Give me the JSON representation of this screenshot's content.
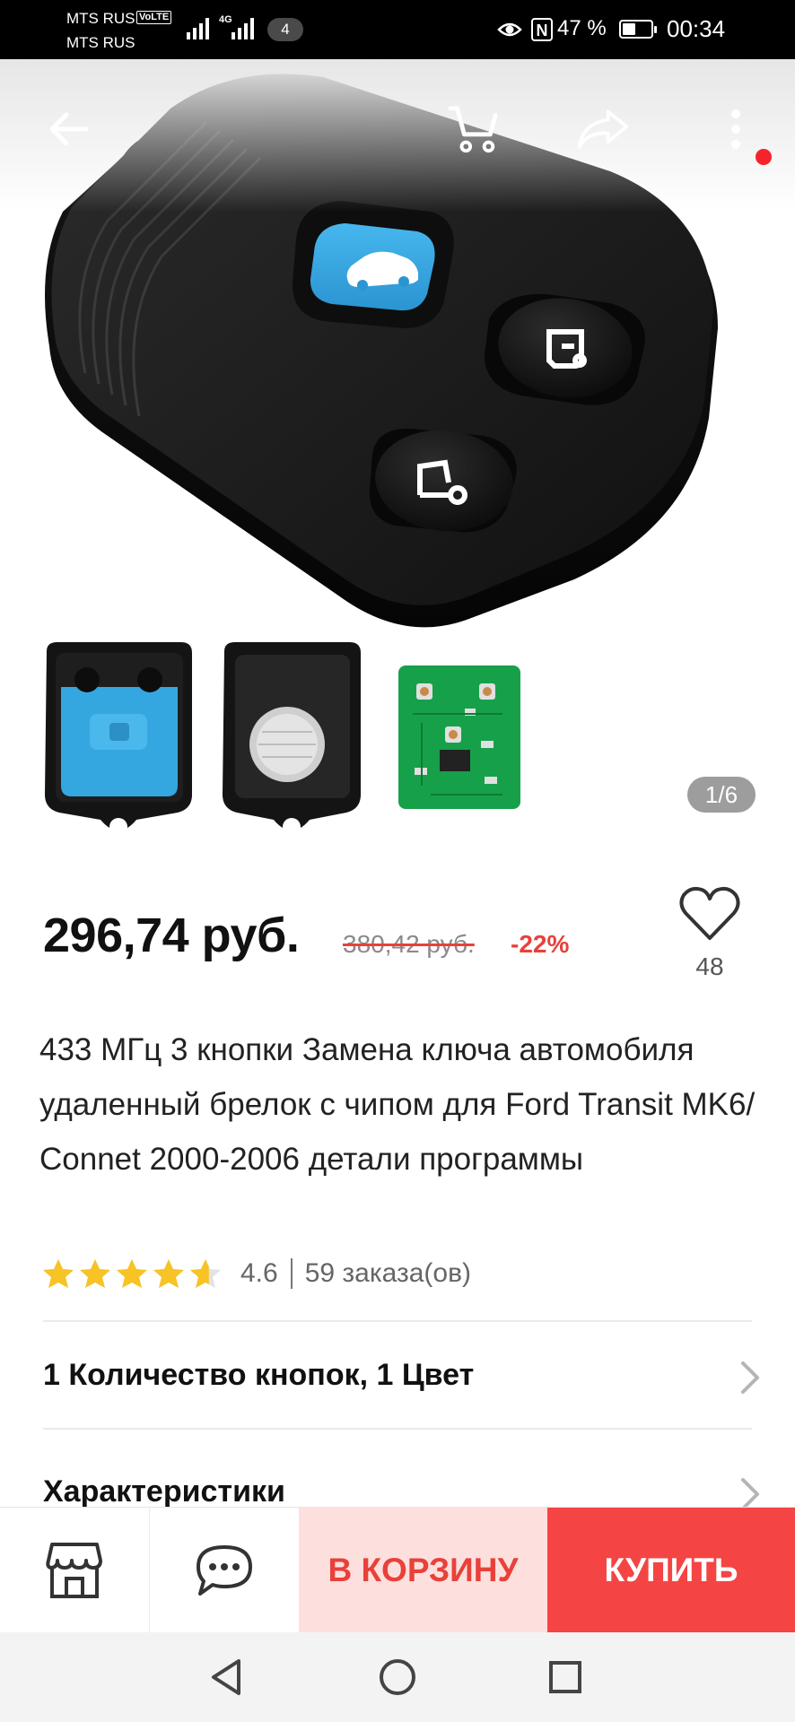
{
  "status_bar": {
    "carrier_1": "MTS RUS",
    "carrier_2": "MTS RUS",
    "volte": "VoLTE",
    "network_type": "4G",
    "notification_count": "4",
    "nfc": "N",
    "battery_text": "47 %",
    "battery_level": 0.47,
    "time": "00:34"
  },
  "top_bar": {
    "icons": [
      "back-arrow-icon",
      "cart-icon",
      "share-icon",
      "more-vertical-icon"
    ],
    "has_notification_dot": true
  },
  "gallery": {
    "counter": "1/6",
    "thumbnails": [
      "case-inside-blue",
      "case-back-battery",
      "circuit-board"
    ]
  },
  "price": {
    "current": "296,74 руб.",
    "old": "380,42 руб.",
    "discount": "-22%"
  },
  "favorites": {
    "count": "48"
  },
  "product": {
    "title": "433 МГц 3 кнопки Замена ключа автомобиля удаленный брелок с чипом для Ford Transit MK6/ Connet 2000-2006 детали программы"
  },
  "rating": {
    "value": "4.6",
    "stars": 4.6,
    "orders": "59 заказа(ов)"
  },
  "options_row": {
    "label": "1 Количество кнопок, 1 Цвет"
  },
  "specs_row": {
    "label": "Характеристики"
  },
  "action_bar": {
    "add_to_cart": "В КОРЗИНУ",
    "buy": "КУПИТЬ"
  },
  "colors": {
    "accent": "#e8413a",
    "buy_bg": "#f54444",
    "cart_bg": "#fde0dd",
    "remote_blue": "#35a7e0",
    "star": "#f7c325"
  }
}
